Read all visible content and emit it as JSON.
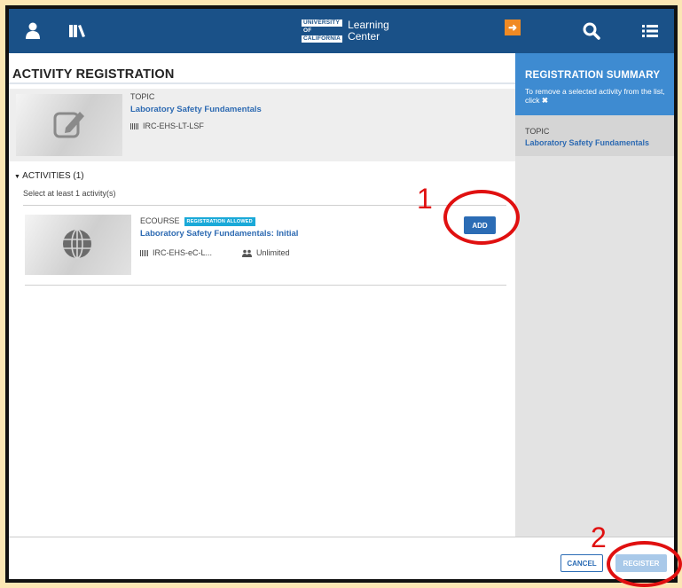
{
  "header": {
    "logo_lines": [
      "UNIVERSITY",
      "OF",
      "CALIFORNIA"
    ],
    "app_name": "Learning Center",
    "icons": [
      "user-icon",
      "library-icon",
      "search-icon",
      "list-menu-icon"
    ]
  },
  "main": {
    "title": "ACTIVITY REGISTRATION",
    "topic": {
      "type": "TOPIC",
      "title": "Laboratory Safety Fundamentals",
      "code": "IRC-EHS-LT-LSF"
    },
    "activities": {
      "header": "ACTIVITIES (1)",
      "hint": "Select at least 1 activity(s)",
      "items": [
        {
          "type": "ECOURSE",
          "badge": "REGISTRATION ALLOWED",
          "title": "Laboratory Safety Fundamentals: Initial",
          "code": "IRC-EHS-eC-L...",
          "seats": "Unlimited",
          "add_label": "ADD"
        }
      ]
    }
  },
  "summary": {
    "title": "REGISTRATION SUMMARY",
    "note": "To remove a selected activity from the list, click",
    "note_icon": "close-icon",
    "item_type": "TOPIC",
    "item_title": "Laboratory Safety Fundamentals"
  },
  "footer": {
    "cancel_label": "CANCEL",
    "register_label": "REGISTER"
  },
  "annotations": {
    "step1": "1",
    "step2": "2",
    "color": "#e01010"
  },
  "colors": {
    "header_bg": "#1a5188",
    "summary_bg": "#3e8bd1",
    "link": "#2d6ab2",
    "badge": "#1aa9d8",
    "accent_orange": "#f08a24"
  }
}
